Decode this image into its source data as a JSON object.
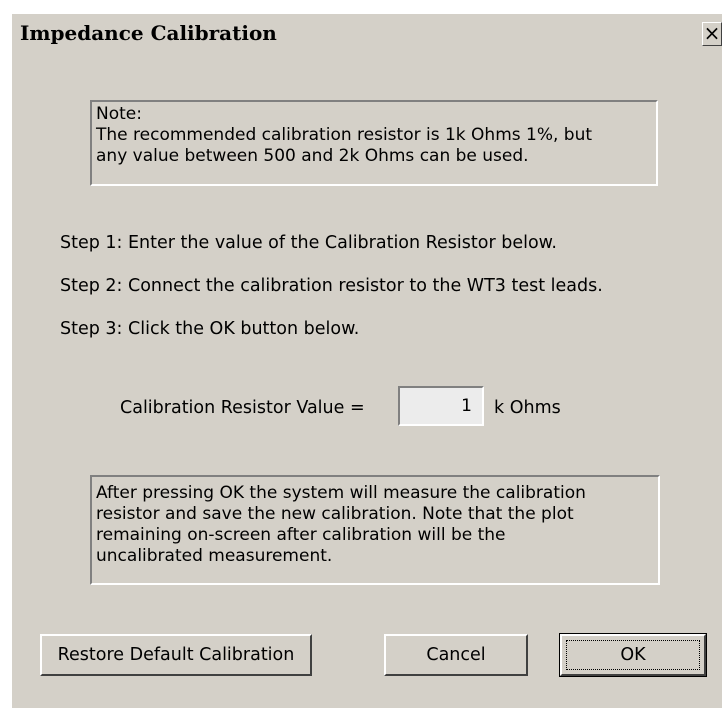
{
  "window": {
    "title": "Impedance Calibration",
    "close_label": "×"
  },
  "note": {
    "lines": [
      "Note:",
      "The recommended calibration resistor is 1k Ohms 1%, but",
      "any value between 500 and 2k Ohms can be used."
    ]
  },
  "steps": [
    "Step 1: Enter the value of the Calibration Resistor below.",
    "Step 2: Connect the calibration resistor to the WT3 test leads.",
    "Step 3: Click the OK button below."
  ],
  "resistor": {
    "label": "Calibration Resistor Value =",
    "value": "1",
    "unit": "k Ohms"
  },
  "info": {
    "lines": [
      "After pressing OK the system will measure the calibration",
      "resistor and save the new calibration. Note that the plot",
      "remaining on-screen after calibration will be the",
      "uncalibrated measurement."
    ]
  },
  "buttons": {
    "restore": "Restore Default Calibration",
    "cancel": "Cancel",
    "ok": "OK"
  }
}
